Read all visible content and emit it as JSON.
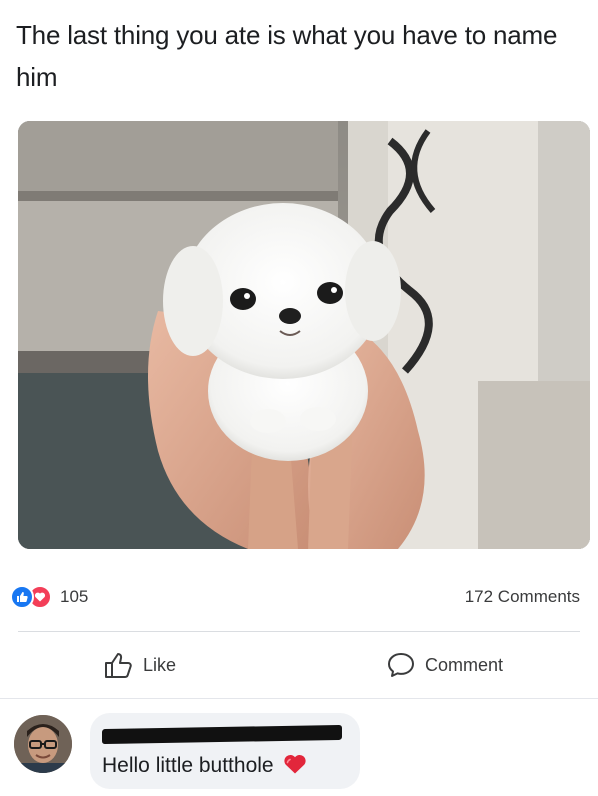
{
  "post": {
    "text": "The last thing you ate is what you have to name him"
  },
  "image": {
    "icon": "puppy-photo"
  },
  "stats": {
    "reaction_count": "105",
    "comments": "172 Comments",
    "like_color": "#1877f2",
    "love_color": "#f33e58"
  },
  "actions": {
    "like": "Like",
    "comment": "Comment"
  },
  "comment": {
    "text": "Hello little butthole",
    "emoji": "heart-emoji"
  }
}
